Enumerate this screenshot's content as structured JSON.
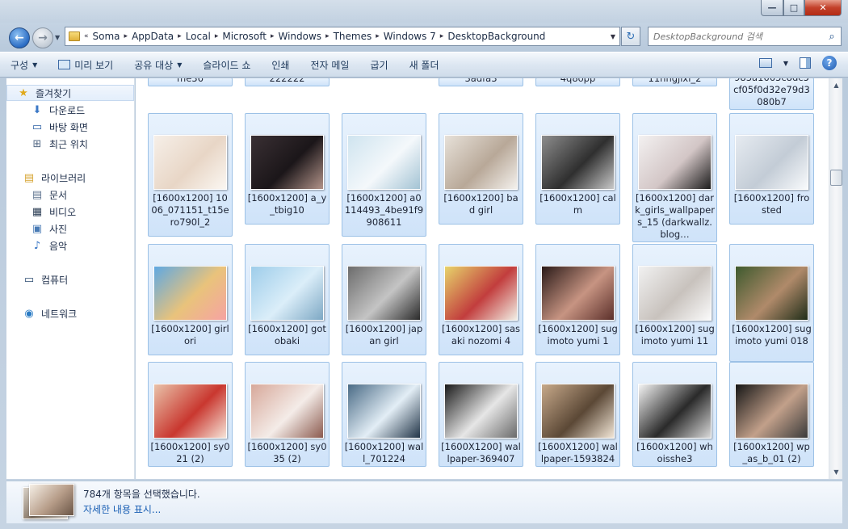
{
  "window": {
    "minimize": "—",
    "maximize": "□",
    "close": "✕"
  },
  "nav": {
    "back_arrow": "←",
    "forward_arrow": "→",
    "dropdown": "▼"
  },
  "address": {
    "overflow": "«",
    "crumbs": [
      "Soma",
      "AppData",
      "Local",
      "Microsoft",
      "Windows",
      "Themes",
      "Windows 7",
      "DesktopBackground"
    ],
    "separator": "▸",
    "dropdown": "▼"
  },
  "refresh_glyph": "↻",
  "search": {
    "placeholder": "DesktopBackground 검색",
    "icon_glyph": "⌕"
  },
  "toolbar": {
    "organize": "구성",
    "preview": "미리 보기",
    "share": "공유 대상",
    "slideshow": "슬라이드 쇼",
    "print": "인쇄",
    "email": "전자 메일",
    "burn": "굽기",
    "new_folder": "새 폴더",
    "arrow": "▼",
    "help": "?"
  },
  "sidebar": {
    "favorites": "즐겨찾기",
    "downloads": "다운로드",
    "desktop": "바탕 화면",
    "recent": "최근 위치",
    "libraries": "라이브러리",
    "documents": "문서",
    "videos": "비디오",
    "pictures": "사진",
    "music": "음악",
    "computer": "컴퓨터",
    "network": "네트워크",
    "icons": {
      "star": "★",
      "download": "⬇",
      "monitor": "▭",
      "recent": "⊞",
      "library": "▤",
      "document": "▤",
      "video": "▦",
      "picture": "▣",
      "music": "♪",
      "computer": "▭",
      "network": "◉"
    }
  },
  "files": {
    "partial_row": [
      "me36",
      "222222",
      "",
      "3adfa3",
      "4q8opp",
      "11nngjlxl_2",
      "983a1663c8dc5cf05f0d32e79d3080b7"
    ],
    "rows": [
      [
        {
          "name": "[1600x1200] 1006_071151_t15ero790l_2",
          "colors": [
            "#f6efe8",
            "#e8d6c6",
            "#fbf7f2"
          ]
        },
        {
          "name": "[1600x1200] a_y_tbig10",
          "colors": [
            "#3a3034",
            "#1b1619",
            "#b3948a"
          ]
        },
        {
          "name": "[1600x1200] a0114493_4be91f9908611",
          "colors": [
            "#cfe4ef",
            "#f4f8fb",
            "#a3c3d4"
          ]
        },
        {
          "name": "[1600x1200] bad girl",
          "colors": [
            "#e7e1d9",
            "#b8a898",
            "#f4f1ed"
          ]
        },
        {
          "name": "[1600x1200] calm",
          "colors": [
            "#8d8d8d",
            "#2f2f2f",
            "#c9c9c9"
          ]
        },
        {
          "name": "[1600x1200] dark_girls_wallpapers_15 (darkwallz.blog…",
          "colors": [
            "#f3f1f1",
            "#d3c6c6",
            "#1c1c1c"
          ]
        },
        {
          "name": "[1600x1200] frosted",
          "colors": [
            "#e6ebf1",
            "#c3ccd6",
            "#f8fafc"
          ]
        }
      ],
      [
        {
          "name": "[1600x1200] girl ori",
          "colors": [
            "#5fa8e2",
            "#e9c37b",
            "#f6a3a3"
          ]
        },
        {
          "name": "[1600x1200] gotobaki",
          "colors": [
            "#9ecdea",
            "#dbeef9",
            "#7da8c4"
          ]
        },
        {
          "name": "[1600x1200] japan girl",
          "colors": [
            "#6c6c6c",
            "#c4c4c4",
            "#2a2a2a"
          ]
        },
        {
          "name": "[1600x1200] sasaki nozomi 4",
          "colors": [
            "#e7d46b",
            "#c23d3d",
            "#f2efe5"
          ]
        },
        {
          "name": "[1600x1200] sugimoto yumi 1",
          "colors": [
            "#2a1a18",
            "#c79482",
            "#5b2f2a"
          ]
        },
        {
          "name": "[1600x1200] sugimoto yumi 11",
          "colors": [
            "#f1f1f1",
            "#c8c2bd",
            "#fafafa"
          ]
        },
        {
          "name": "[1600x1200] sugimoto yumi 018",
          "colors": [
            "#3e5a2e",
            "#b08a6a",
            "#1f2d18"
          ]
        }
      ],
      [
        {
          "name": "[1600x1200] sy021 (2)",
          "colors": [
            "#e9c2a9",
            "#c9372f",
            "#f6e4d8"
          ]
        },
        {
          "name": "[1600x1200] sy035 (2)",
          "colors": [
            "#d7a89a",
            "#f4ece8",
            "#8b5a4e"
          ]
        },
        {
          "name": "[1600x1200] wall_701224",
          "colors": [
            "#4a6b86",
            "#e3eef6",
            "#213447"
          ]
        },
        {
          "name": "[1600X1200] wallpaper-369407",
          "colors": [
            "#1a1a1a",
            "#e6e6e6",
            "#6a6a6a"
          ]
        },
        {
          "name": "[1600X1200] wallpaper-1593824",
          "colors": [
            "#c7a98a",
            "#5b4836",
            "#f2e6d6"
          ]
        },
        {
          "name": "[1600x1200] whoisshe3",
          "colors": [
            "#f4f4f4",
            "#2a2a2a",
            "#d9d9d9"
          ]
        },
        {
          "name": "[1600x1200] wp_as_b_01 (2)",
          "colors": [
            "#161616",
            "#c2a08a",
            "#3a3a3a"
          ]
        }
      ]
    ]
  },
  "scroll": {
    "up": "▲",
    "down": "▼"
  },
  "details": {
    "count_text": "784개 항목을 선택했습니다.",
    "link_text": "자세한 내용 표시..."
  }
}
